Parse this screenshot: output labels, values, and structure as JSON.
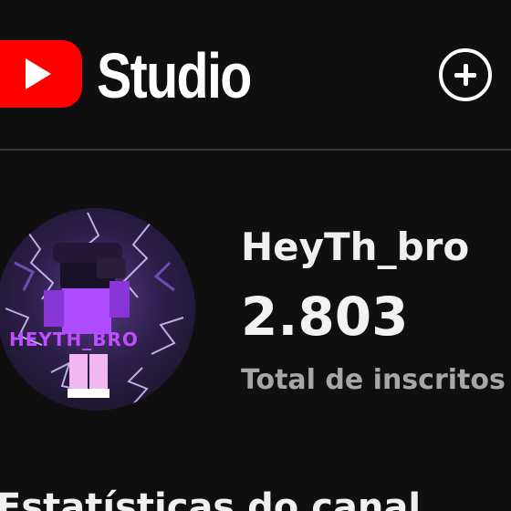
{
  "header": {
    "logo_icon": "youtube-logo-icon",
    "studio_label": "Studio",
    "create_icon": "plus-circle-icon"
  },
  "channel": {
    "avatar_text": "HEYTH_BRO",
    "name": "HeyTh_bro",
    "subscriber_count": "2.803",
    "subscriber_label": "Total de inscritos"
  },
  "sections": {
    "stats_title": "Estatísticas do canal"
  },
  "colors": {
    "background": "#0f0f10",
    "brand_red": "#ff0000",
    "text_primary": "#f1f1f1",
    "text_secondary": "#a7a7a7"
  }
}
